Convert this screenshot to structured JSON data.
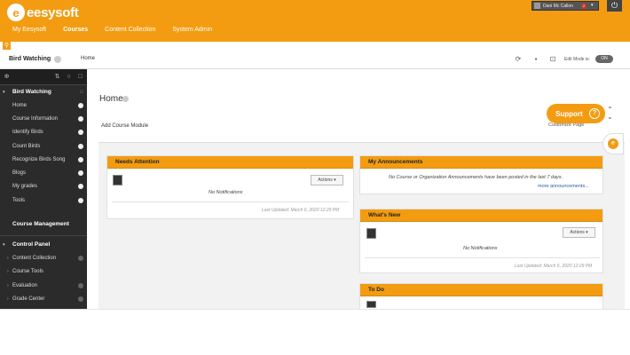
{
  "brand": {
    "logo_letter": "e",
    "name": "eesysoft"
  },
  "user": {
    "name": "Dani Mc Callon",
    "notifications": "2"
  },
  "topnav": {
    "items": [
      "My Eesysoft",
      "Courses",
      "Content Collection",
      "System Admin"
    ],
    "active": "Courses"
  },
  "course": {
    "title": "Bird Watching",
    "breadcrumb": "Home"
  },
  "editmode": {
    "label": "Edit Mode is:",
    "state": "ON"
  },
  "sidebar": {
    "course_title": "Bird Watching",
    "items": [
      "Home",
      "Course Information",
      "Identify Birds",
      "Count Birds",
      "Recognize Birds Song",
      "Blogs",
      "My grades",
      "Tools"
    ],
    "management_title": "Course Management",
    "control_panel": "Control Panel",
    "cp_items": [
      "Content Collection",
      "Course Tools",
      "Evaluation",
      "Grade Center"
    ]
  },
  "page": {
    "title": "Home",
    "add_module": "Add Course Module",
    "customize": "Customize Page"
  },
  "modules": {
    "needs_attention": {
      "title": "Needs Attention",
      "actions": "Actions",
      "empty": "No Notifications",
      "updated": "Last Updated: March 6, 2020 12:29 PM"
    },
    "announcements": {
      "title": "My Announcements",
      "empty": "No Course or Organization Announcements have been posted in the last 7 days.",
      "more": "more announcements..."
    },
    "whats_new": {
      "title": "What's New",
      "actions": "Actions",
      "empty": "No Notifications",
      "updated": "Last Updated: March 6, 2020 12:29 PM"
    },
    "todo": {
      "title": "To Do"
    }
  },
  "support": {
    "label": "Support",
    "icon": "?"
  },
  "colors": {
    "brand": "#f39c12",
    "sidebar": "#2b2b2b"
  },
  "icons": [
    "pin-icon",
    "power-icon",
    "refresh-icon",
    "folder-icon",
    "lock-icon",
    "settings-icon",
    "sort-icon",
    "home-icon",
    "question-icon"
  ]
}
